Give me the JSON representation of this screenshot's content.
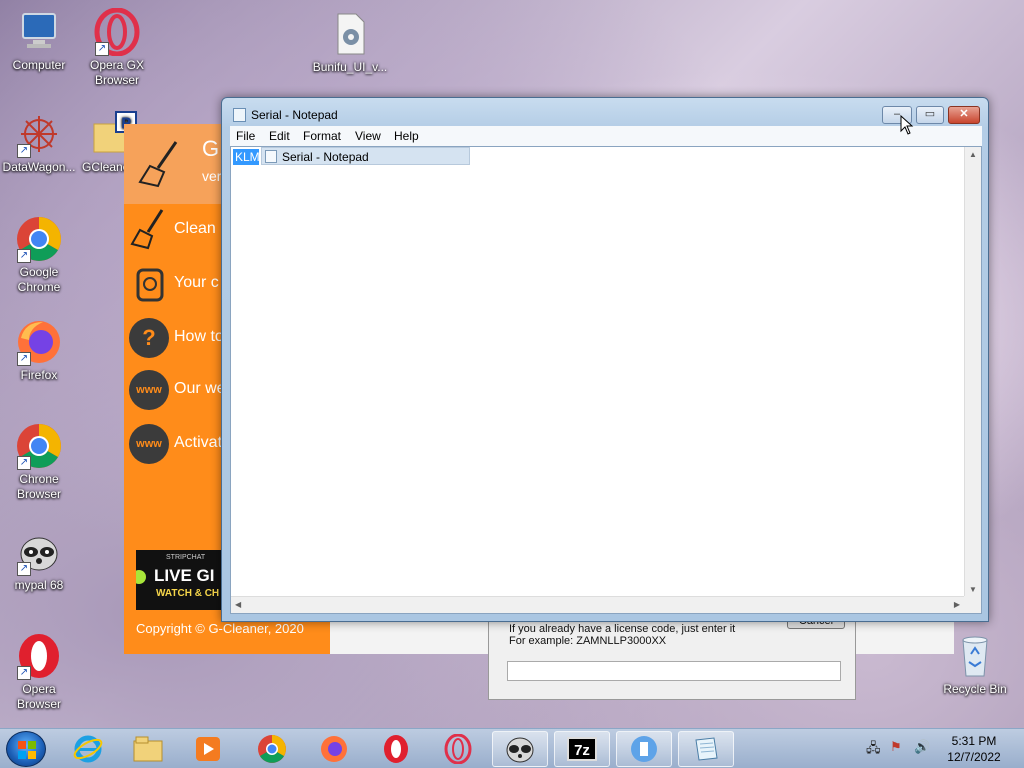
{
  "desktop": {
    "icons": [
      {
        "label": "Computer"
      },
      {
        "label": "Opera GX Browser"
      },
      {
        "label": "Bunifu_UI_v..."
      },
      {
        "label": "DataWagon..."
      },
      {
        "label": "GCleane"
      },
      {
        "label": "Google Chrome"
      },
      {
        "label": "Firefox"
      },
      {
        "label": "Chrone Browser"
      },
      {
        "label": "mypal 68"
      },
      {
        "label": "Opera Browser"
      },
      {
        "label": "Recycle Bin"
      }
    ]
  },
  "gcleaner": {
    "title": "G",
    "subtitle": "ver",
    "menu": [
      {
        "label": "Clean",
        "icon": "broom-icon"
      },
      {
        "label": "Your c",
        "icon": "disk-icon"
      },
      {
        "label": "How to",
        "icon": "question-icon"
      },
      {
        "label": "Our we",
        "icon": "www-icon"
      },
      {
        "label": "Activat",
        "icon": "www-icon"
      }
    ],
    "icon_text_www": "www",
    "ad": {
      "brand": "STRIPCHAT",
      "line1": "LIVE GI",
      "line2": "WATCH & CH"
    },
    "copyright": "Copyright © G-Cleaner, 2020",
    "license_dialog": {
      "line1": "If you already have a license code, just enter it",
      "line2": "For example: ZAMNLLP3000XX",
      "cancel": "Cancel",
      "input_value": ""
    }
  },
  "notepad": {
    "title": "Serial - Notepad",
    "menu": [
      "File",
      "Edit",
      "Format",
      "View",
      "Help"
    ],
    "selected_text": "KLMI",
    "tooltip": "Serial - Notepad",
    "controls": {
      "minimize": "–",
      "maximize": "▭",
      "close": "✕"
    }
  },
  "taskbar": {
    "clock_time": "5:31 PM",
    "clock_date": "12/7/2022",
    "apps": [
      "ie-icon",
      "explorer-icon",
      "media-player-icon",
      "chrome-icon",
      "firefox-icon",
      "opera-icon",
      "opera-gx-icon",
      "mypal-icon",
      "7zip-icon",
      "gcleaner-icon",
      "notepad-icon"
    ],
    "sevenzip_label": "7z"
  },
  "colors": {
    "accent_orange": "#ff8c1a",
    "selection": "#3399ff",
    "title_bar": "#b4cde6"
  }
}
